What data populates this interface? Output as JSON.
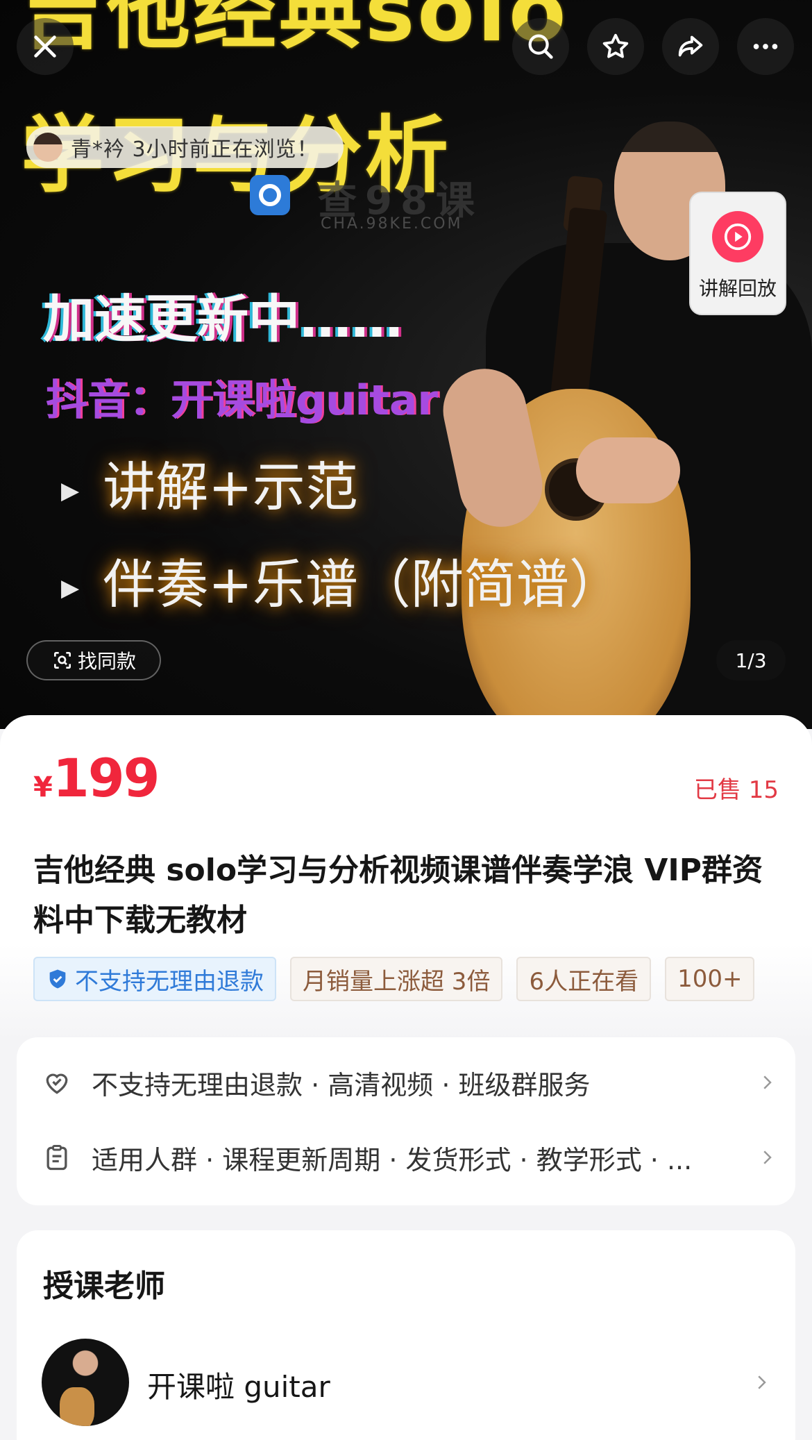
{
  "hero": {
    "title_line1": "吉他经典solo",
    "title_line2": "学习与分析",
    "update_line": "加速更新中……",
    "douyin_line": "抖音：开课啦guitar",
    "bullet1": "讲解+示范",
    "bullet2": "伴奏+乐谱（附简谱）",
    "watermark_text": "查98课",
    "watermark_sub": "CHA.98KE.COM",
    "browse_text": "青*衿 3小时前正在浏览！",
    "replay_label": "讲解回放",
    "find_same_label": "找同款",
    "pager": "1/3"
  },
  "product": {
    "currency": "¥",
    "price": "199",
    "sold": "已售 15",
    "title": "吉他经典 solo学习与分析视频课谱伴奏学浪 VIP群资料中下载无教材",
    "tags": [
      "不支持无理由退款",
      "月销量上涨超 3倍",
      "6人正在看",
      "100+"
    ]
  },
  "service": {
    "row1": "不支持无理由退款 · 高清视频 · 班级群服务",
    "row2": "适用人群 · 课程更新周期 · 发货形式 · 教学形式 · ..."
  },
  "teacher": {
    "heading": "授课老师",
    "name": "开课啦 guitar"
  },
  "colors": {
    "price_red": "#f0263c",
    "accent_pink": "#fe3c62",
    "hero_yellow": "#f4de3a",
    "tag_blue": "#2f7ad8"
  },
  "icons": [
    "close-icon",
    "search-icon",
    "star-icon",
    "share-icon",
    "more-icon",
    "play-icon",
    "scan-icon",
    "shield-icon",
    "heart-icon",
    "clipboard-icon",
    "chevron-right-icon"
  ]
}
